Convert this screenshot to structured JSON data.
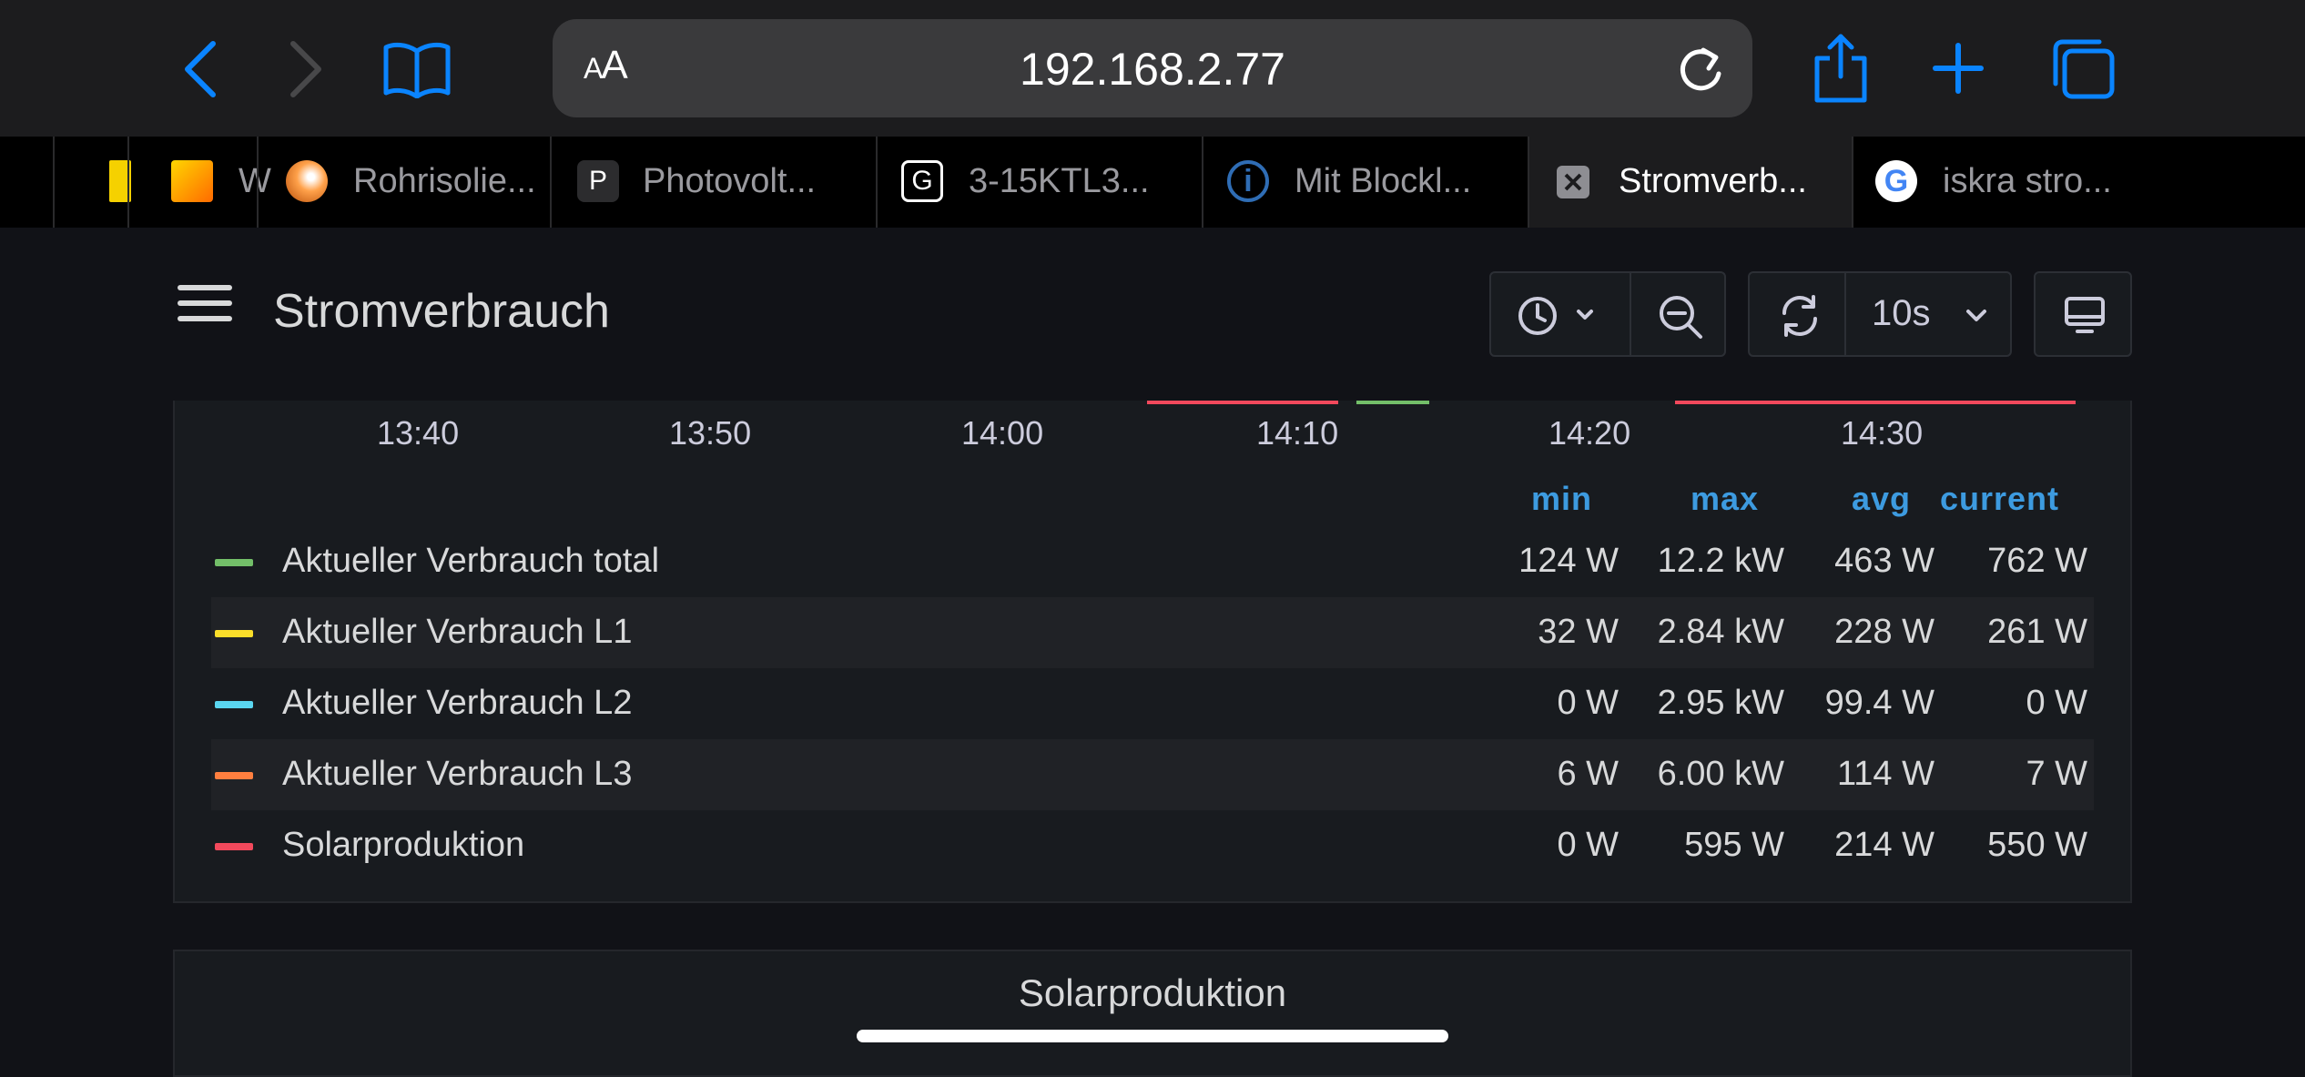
{
  "browser": {
    "url": "192.168.2.77",
    "text_size_label": "AA",
    "tabs": [
      {
        "label": "W",
        "active": false
      },
      {
        "label": "Rohrisolie...",
        "active": false
      },
      {
        "label": "Photovolt...",
        "active": false,
        "favicon_letter": "P"
      },
      {
        "label": "3-15KTL3...",
        "active": false,
        "favicon_letter": "G"
      },
      {
        "label": "Mit Blockl...",
        "active": false,
        "favicon_letter": "i"
      },
      {
        "label": "Stromverb...",
        "active": true
      },
      {
        "label": "iskra stro...",
        "active": false,
        "favicon_letter": "G"
      }
    ]
  },
  "dashboard": {
    "title": "Stromverbrauch",
    "refresh_interval": "10s"
  },
  "panel": {
    "x_ticks": [
      "13:40",
      "13:50",
      "14:00",
      "14:10",
      "14:20",
      "14:30"
    ],
    "legend_headers": {
      "min": "min",
      "max": "max",
      "avg": "avg",
      "current": "current"
    },
    "legend_rows": [
      {
        "name": "Aktueller Verbrauch total",
        "color": "#73bf69",
        "min": "124 W",
        "max": "12.2 kW",
        "avg": "463 W",
        "current": "762 W"
      },
      {
        "name": "Aktueller Verbrauch L1",
        "color": "#fade2a",
        "min": "32 W",
        "max": "2.84 kW",
        "avg": "228 W",
        "current": "261 W"
      },
      {
        "name": "Aktueller Verbrauch L2",
        "color": "#5ad6f0",
        "min": "0 W",
        "max": "2.95 kW",
        "avg": "99.4 W",
        "current": "0 W"
      },
      {
        "name": "Aktueller Verbrauch L3",
        "color": "#ff7f3f",
        "min": "6 W",
        "max": "6.00 kW",
        "avg": "114 W",
        "current": "7 W"
      },
      {
        "name": "Solarproduktion",
        "color": "#f2495c",
        "min": "0 W",
        "max": "595 W",
        "avg": "214 W",
        "current": "550 W"
      }
    ]
  },
  "panel2": {
    "title": "Solarproduktion"
  },
  "colors": {
    "accent": "#3d9be0",
    "ios_blue": "#0a84ff",
    "background": "#111217",
    "panel": "#181b1f"
  }
}
